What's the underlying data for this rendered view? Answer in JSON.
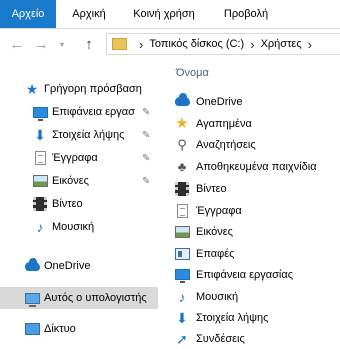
{
  "ribbon": {
    "tabs": [
      {
        "label": "Αρχείο",
        "active": true
      },
      {
        "label": "Αρχική",
        "active": false
      },
      {
        "label": "Κοινή χρήση",
        "active": false
      },
      {
        "label": "Προβολή",
        "active": false
      }
    ]
  },
  "address": {
    "separator": "›",
    "crumbs": [
      "Τοπικός δίσκος (C:)",
      "›",
      "Χρήστες",
      "›"
    ]
  },
  "sidebar": {
    "items": [
      {
        "label": "Γρήγορη πρόσβαση",
        "icon": "star-icon"
      },
      {
        "label": "Επιφάνεια εργασ",
        "icon": "desktop-icon",
        "pinned": true
      },
      {
        "label": "Στοιχεία λήψης",
        "icon": "download-arrow-icon",
        "pinned": true
      },
      {
        "label": "Έγγραφα",
        "icon": "document-icon",
        "pinned": true
      },
      {
        "label": "Εικόνες",
        "icon": "pictures-icon",
        "pinned": true
      },
      {
        "label": "Βίντεο",
        "icon": "video-film-icon"
      },
      {
        "label": "Μουσική",
        "icon": "music-note-icon"
      },
      {
        "label": "OneDrive",
        "icon": "onedrive-cloud-icon"
      },
      {
        "label": "Αυτός ο υπολογιστής",
        "icon": "this-pc-icon",
        "selected": true
      },
      {
        "label": "Δίκτυο",
        "icon": "network-icon"
      }
    ]
  },
  "main": {
    "column_header": "Όνομα",
    "items": [
      {
        "label": "OneDrive",
        "icon": "onedrive-cloud-icon"
      },
      {
        "label": "Αγαπημένα",
        "icon": "favorites-star-icon"
      },
      {
        "label": "Αναζητήσεις",
        "icon": "search-magnifier-icon"
      },
      {
        "label": "Αποθηκευμένα παιχνίδια",
        "icon": "saved-games-icon"
      },
      {
        "label": "Βίντεο",
        "icon": "video-film-icon"
      },
      {
        "label": "Έγγραφα",
        "icon": "document-icon"
      },
      {
        "label": "Εικόνες",
        "icon": "pictures-icon"
      },
      {
        "label": "Επαφές",
        "icon": "contacts-icon"
      },
      {
        "label": "Επιφάνεια εργασίας",
        "icon": "desktop-icon"
      },
      {
        "label": "Μουσική",
        "icon": "music-note-icon"
      },
      {
        "label": "Στοιχεία λήψης",
        "icon": "download-arrow-icon"
      },
      {
        "label": "Συνδέσεις",
        "icon": "links-arrow-icon"
      }
    ]
  },
  "colors": {
    "accent": "#1979ca",
    "selected_bg": "#d9d9d9",
    "header_text": "#4c607a"
  }
}
